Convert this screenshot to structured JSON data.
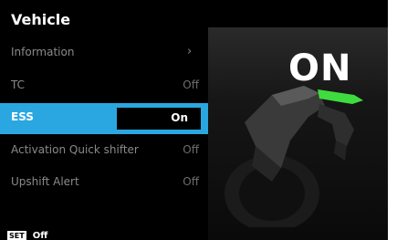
{
  "title": "Vehicle",
  "menu": [
    {
      "label": "Information",
      "value": "",
      "chevron": "›"
    },
    {
      "label": "TC",
      "value": "Off"
    },
    {
      "label": "ESS",
      "value": "On",
      "selected": true
    },
    {
      "label": "Activation Quick shifter",
      "value": "Off"
    },
    {
      "label": "Upshift Alert",
      "value": "Off"
    }
  ],
  "status_display": {
    "text": "ON"
  },
  "footer": {
    "badge": "SET",
    "status": "Off"
  },
  "colors": {
    "accent": "#2aa7e0",
    "indicator_light": "#3fdc3f",
    "background": "#000000"
  }
}
